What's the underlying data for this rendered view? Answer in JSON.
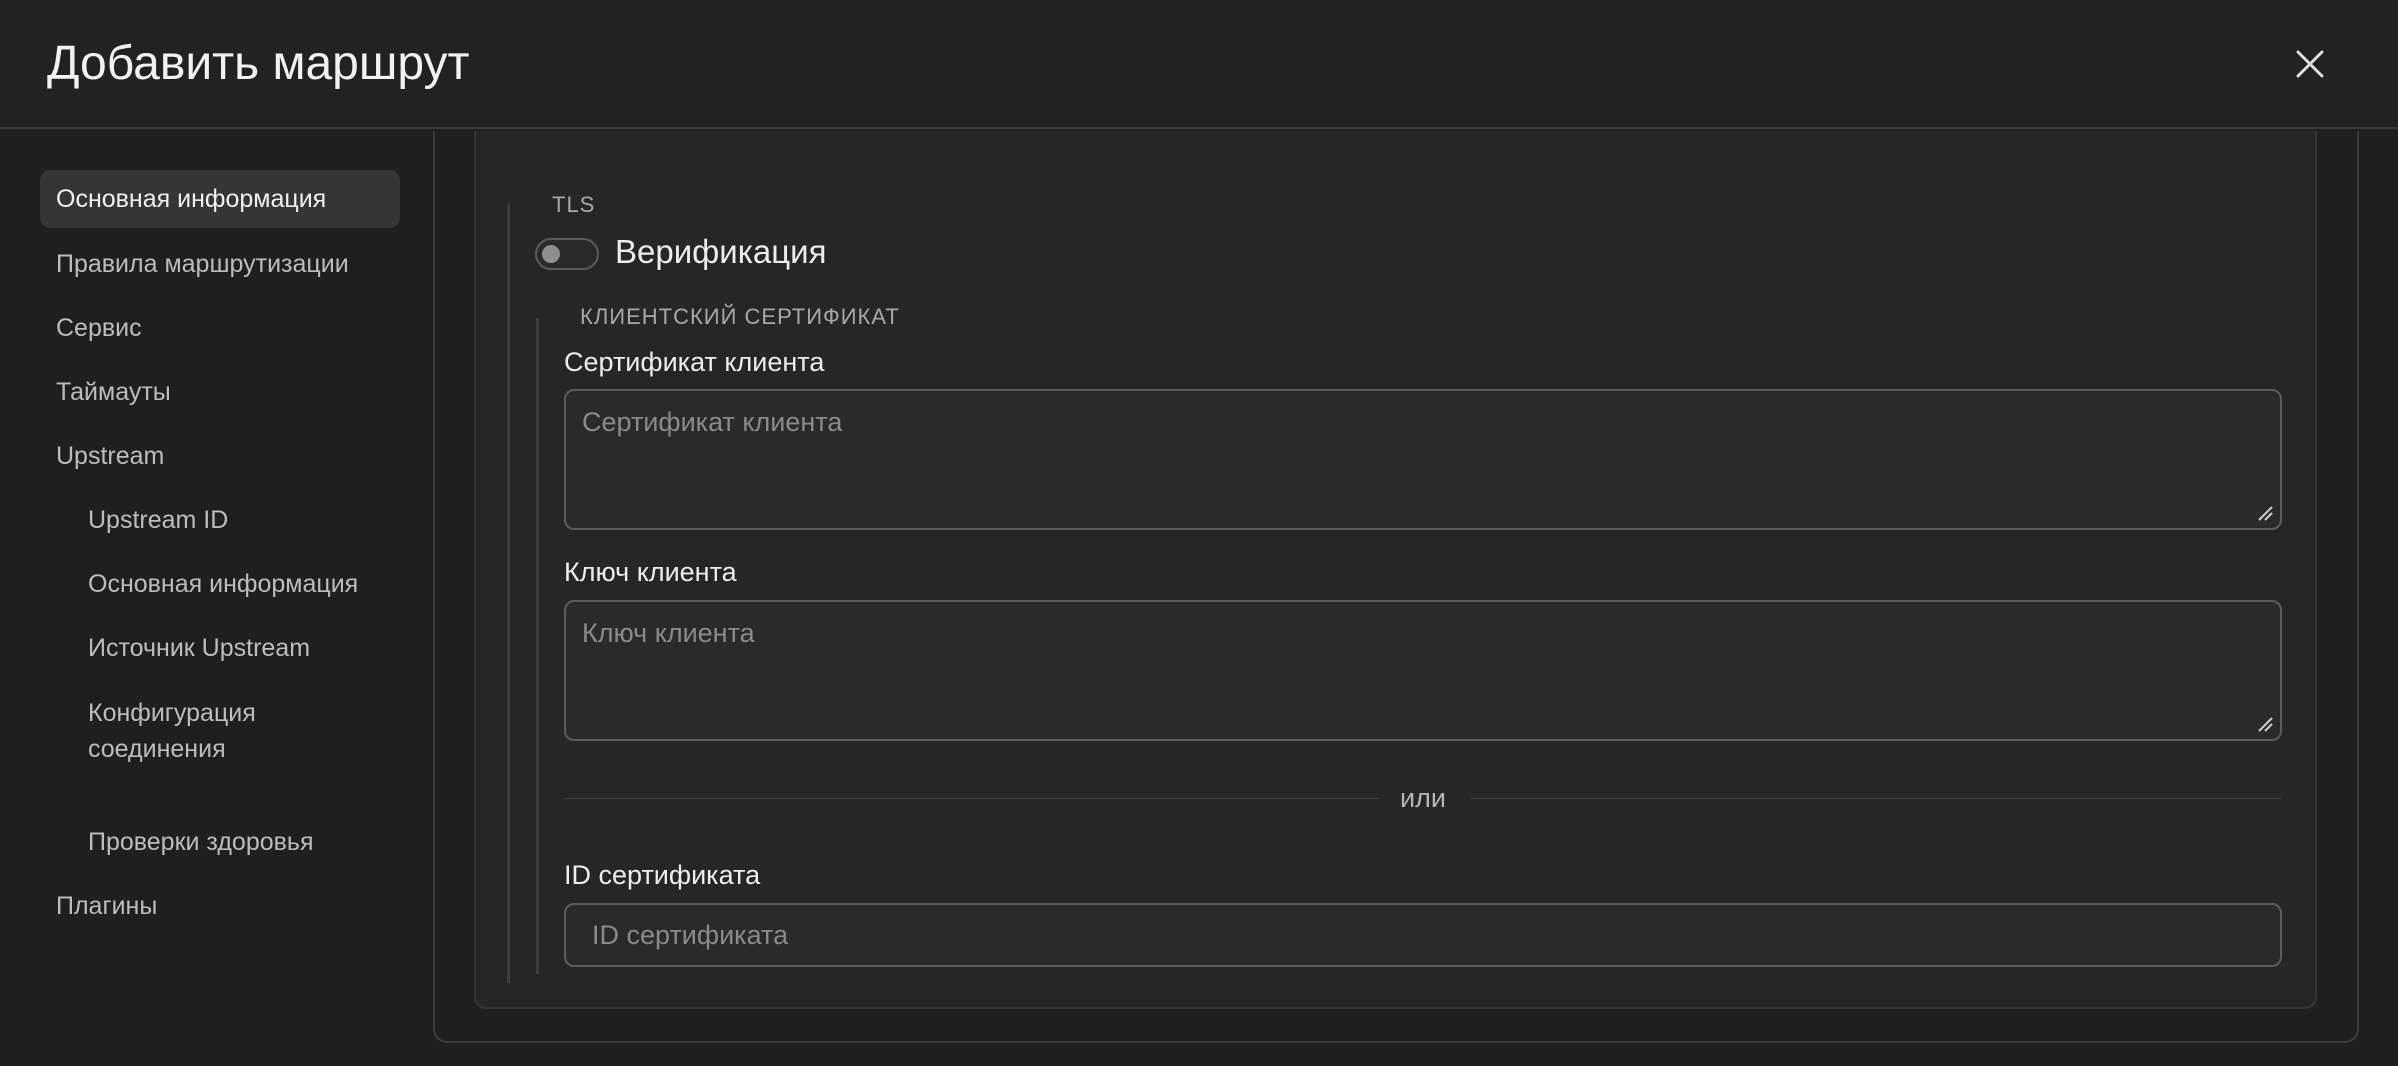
{
  "header": {
    "title": "Добавить маршрут",
    "close_icon": "close-icon"
  },
  "sidebar": {
    "items": [
      {
        "label": "Основная информация",
        "active": true
      },
      {
        "label": "Правила маршрутизации"
      },
      {
        "label": "Сервис"
      },
      {
        "label": "Таймауты"
      },
      {
        "label": "Upstream"
      },
      {
        "label": "Upstream ID",
        "level": 2
      },
      {
        "label": "Основная информация",
        "level": 2
      },
      {
        "label": "Источник Upstream",
        "level": 2
      },
      {
        "label": "Конфигурация соединения",
        "level": 2
      },
      {
        "label": "Проверки здоровья",
        "level": 2
      },
      {
        "label": "Плагины"
      }
    ]
  },
  "form": {
    "tls_section": "TLS",
    "verification": {
      "label": "Верификация",
      "enabled": false
    },
    "client_cert_section": "КЛИЕНТСКИЙ СЕРТИФИКАТ",
    "client_cert": {
      "label": "Сертификат клиента",
      "placeholder": "Сертификат клиента",
      "value": ""
    },
    "client_key": {
      "label": "Ключ клиента",
      "placeholder": "Ключ клиента",
      "value": ""
    },
    "or_divider": "или",
    "cert_id": {
      "label": "ID сертификата",
      "placeholder": "ID сертификата",
      "value": ""
    }
  },
  "colors": {
    "background": "#1f1f1f",
    "card": "#262626",
    "active_item": "#353535",
    "border": "#5c5c5c"
  }
}
